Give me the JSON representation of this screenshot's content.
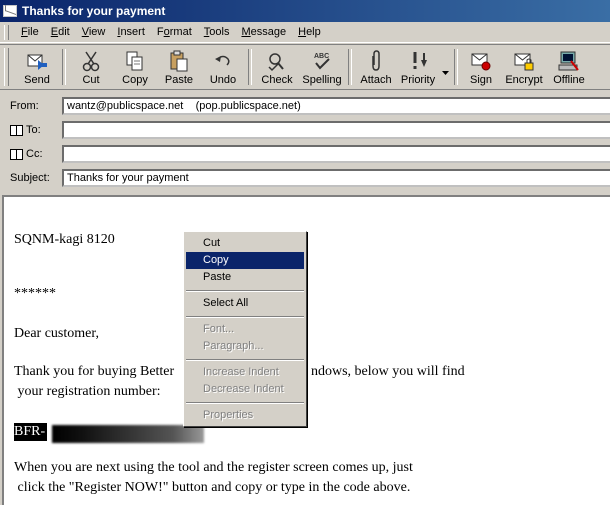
{
  "window": {
    "title": "Thanks for your payment"
  },
  "menu": [
    "File",
    "Edit",
    "View",
    "Insert",
    "Format",
    "Tools",
    "Message",
    "Help"
  ],
  "menu_underline": [
    "F",
    "E",
    "V",
    "I",
    "o",
    "T",
    "M",
    "H"
  ],
  "toolbar": {
    "send": "Send",
    "cut": "Cut",
    "copy": "Copy",
    "paste": "Paste",
    "undo": "Undo",
    "check": "Check",
    "spelling": "Spelling",
    "attach": "Attach",
    "priority": "Priority",
    "sign": "Sign",
    "encrypt": "Encrypt",
    "offline": "Offline"
  },
  "header": {
    "from_label": "From:",
    "from_value": "wantz@publicspace.net    (pop.publicspace.net)",
    "to_label": "To:",
    "to_value": "",
    "cc_label": "Cc:",
    "cc_value": "",
    "subject_label": "Subject:",
    "subject_value": "Thanks for your payment"
  },
  "body": {
    "line1": "SQNM-kagi 8120",
    "line2": "******",
    "line3": "Dear customer,",
    "line4a": "Thank you for buying Better",
    "line4b": "ndows, below you will find",
    "line5": " your registration number:",
    "code_prefix": "BFR-",
    "line6": "When you are next using the tool and the register screen comes up, just",
    "line7": " click the \"Register NOW!\" button and copy or type in the code above."
  },
  "context_menu": {
    "cut": "Cut",
    "copy": "Copy",
    "paste": "Paste",
    "select_all": "Select All",
    "font": "Font...",
    "paragraph": "Paragraph...",
    "increase_indent": "Increase Indent",
    "decrease_indent": "Decrease Indent",
    "properties": "Properties"
  }
}
